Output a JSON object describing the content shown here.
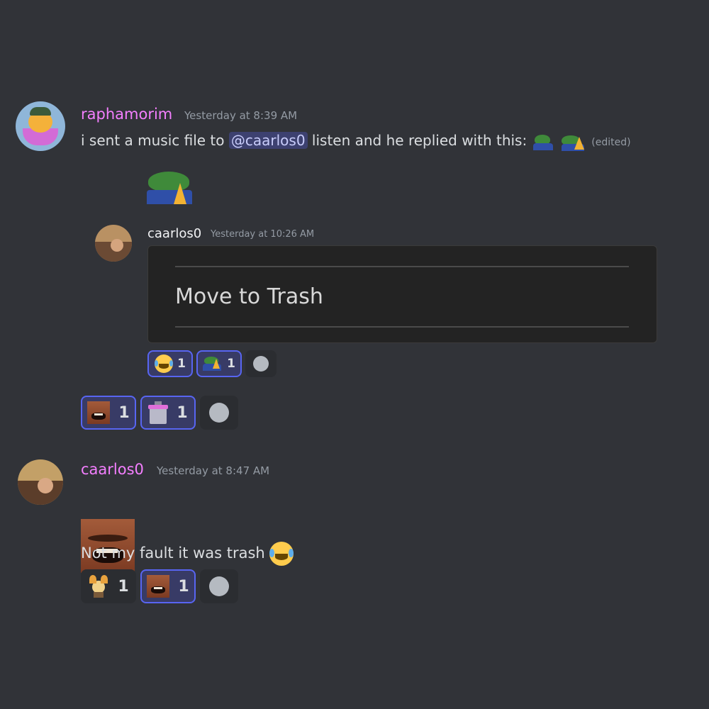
{
  "messages": [
    {
      "username": "raphamorim",
      "username_color": "#f47fff",
      "timestamp": "Yesterday at 8:39 AM",
      "text_before": "i sent a music file to",
      "mention": "@caarlos0",
      "text_after": "listen and he replied with this:",
      "edited": "(edited)",
      "reactions": [
        {
          "emoji": "face-laughing-image",
          "count": "1",
          "me": true
        },
        {
          "emoji": "trash-can-sticker",
          "count": "1",
          "me": true
        }
      ]
    },
    {
      "username": "caarlos0",
      "username_color": "#f47fff",
      "timestamp": "Yesterday at 8:47 AM",
      "text": "Not my fault it was trash",
      "reactions": [
        {
          "emoji": "character-sticker",
          "count": "1",
          "me": false
        },
        {
          "emoji": "face-laughing-image",
          "count": "1",
          "me": true
        }
      ]
    }
  ],
  "quoted": {
    "username": "caarlos0",
    "timestamp": "Yesterday at 10:26 AM",
    "menu_item": "Move to Trash",
    "reactions": [
      {
        "emoji": "joy-emoji",
        "count": "1",
        "me": true
      },
      {
        "emoji": "pepe-emoji",
        "count": "1",
        "me": true
      }
    ]
  },
  "colors": {
    "background": "#313338",
    "accent": "#5865f2",
    "timestamp": "#949ba4"
  }
}
